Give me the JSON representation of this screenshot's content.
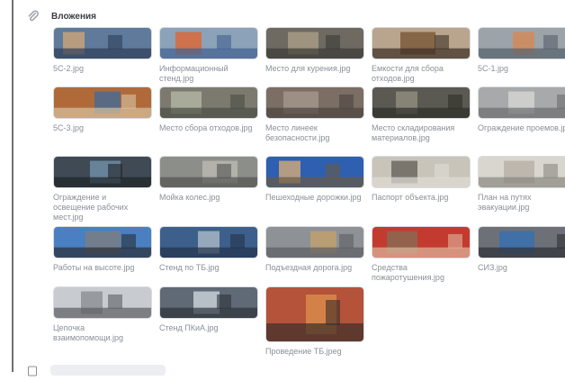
{
  "section": {
    "title": "Вложения",
    "icon": "paperclip-icon"
  },
  "attachments": [
    {
      "name": "5С-2.jpg",
      "colors": [
        "#5f7a9a",
        "#c8a27a",
        "#2d3e5a"
      ]
    },
    {
      "name": "Информационный стенд.jpg",
      "colors": [
        "#8ca2b8",
        "#d86a3a",
        "#3f5f8f"
      ]
    },
    {
      "name": "Место для курения.jpg",
      "colors": [
        "#6e6a62",
        "#a69a84",
        "#3b3a36"
      ]
    },
    {
      "name": "Емкости для сбора отходов.jpg",
      "colors": [
        "#b9a58d",
        "#7b5b3a",
        "#3a2e24"
      ]
    },
    {
      "name": "5С-1.jpg",
      "colors": [
        "#9ca3a9",
        "#d28b5a",
        "#56606a"
      ]
    },
    {
      "name": "5С-3.jpg",
      "colors": [
        "#b06a3a",
        "#4c6a92",
        "#d9c4a3"
      ]
    },
    {
      "name": "Место сбора отходов.jpg",
      "colors": [
        "#7c7a6f",
        "#b0b4a2",
        "#4a4d44"
      ]
    },
    {
      "name": "Место линеек безопасности.jpg",
      "colors": [
        "#7b6e64",
        "#a2958a",
        "#4b433e"
      ]
    },
    {
      "name": "Место складирования материалов.jpg",
      "colors": [
        "#5a5a52",
        "#8f8b7c",
        "#2e2e2a"
      ]
    },
    {
      "name": "Ограждение проемов.jpg",
      "colors": [
        "#a7a9aa",
        "#d4d4d2",
        "#6a6c6d"
      ]
    },
    {
      "name": "Ограждение и освещение рабочих мест.jpg",
      "colors": [
        "#3f4a55",
        "#6f8da6",
        "#1f2328"
      ]
    },
    {
      "name": "Мойка колес.jpg",
      "colors": [
        "#8c8e89",
        "#b9b9b0",
        "#525450"
      ]
    },
    {
      "name": "Пешеходные дорожки.jpg",
      "colors": [
        "#2e5fb0",
        "#c9a77c",
        "#6b5a45"
      ]
    },
    {
      "name": "Паспорт объекта.jpg",
      "colors": [
        "#c8c4ba",
        "#6c6860",
        "#e0ddd6"
      ]
    },
    {
      "name": "План на путях эвакуации.jpg",
      "colors": [
        "#d9d6cf",
        "#b7b2a8",
        "#8a8680"
      ]
    },
    {
      "name": "Работы на высоте.jpg",
      "colors": [
        "#4a7fc1",
        "#7a7e84",
        "#2a2e34"
      ]
    },
    {
      "name": "Стенд по ТБ.jpg",
      "colors": [
        "#3d5f8c",
        "#a6b5c4",
        "#23324a"
      ]
    },
    {
      "name": "Подъездная дорога.jpg",
      "colors": [
        "#8e9196",
        "#c0a06e",
        "#5b5e63"
      ]
    },
    {
      "name": "Средства пожаротушения.jpg",
      "colors": [
        "#c33a2e",
        "#8a6a52",
        "#e0b8a0"
      ]
    },
    {
      "name": "СИЗ.jpg",
      "colors": [
        "#6d7177",
        "#3a6fb0",
        "#2e3136"
      ]
    },
    {
      "name": "Цепочка взаимопомощи.jpg",
      "colors": [
        "#c8cbcf",
        "#8e9297",
        "#5a5e63"
      ]
    },
    {
      "name": "Стенд ПКиА.jpg",
      "colors": [
        "#5f6a76",
        "#c8cfd6",
        "#2c333b"
      ]
    },
    {
      "name": "Проведение ТБ.jpeg",
      "colors": [
        "#b4523a",
        "#d98a4a",
        "#3a2f2a"
      ]
    }
  ]
}
